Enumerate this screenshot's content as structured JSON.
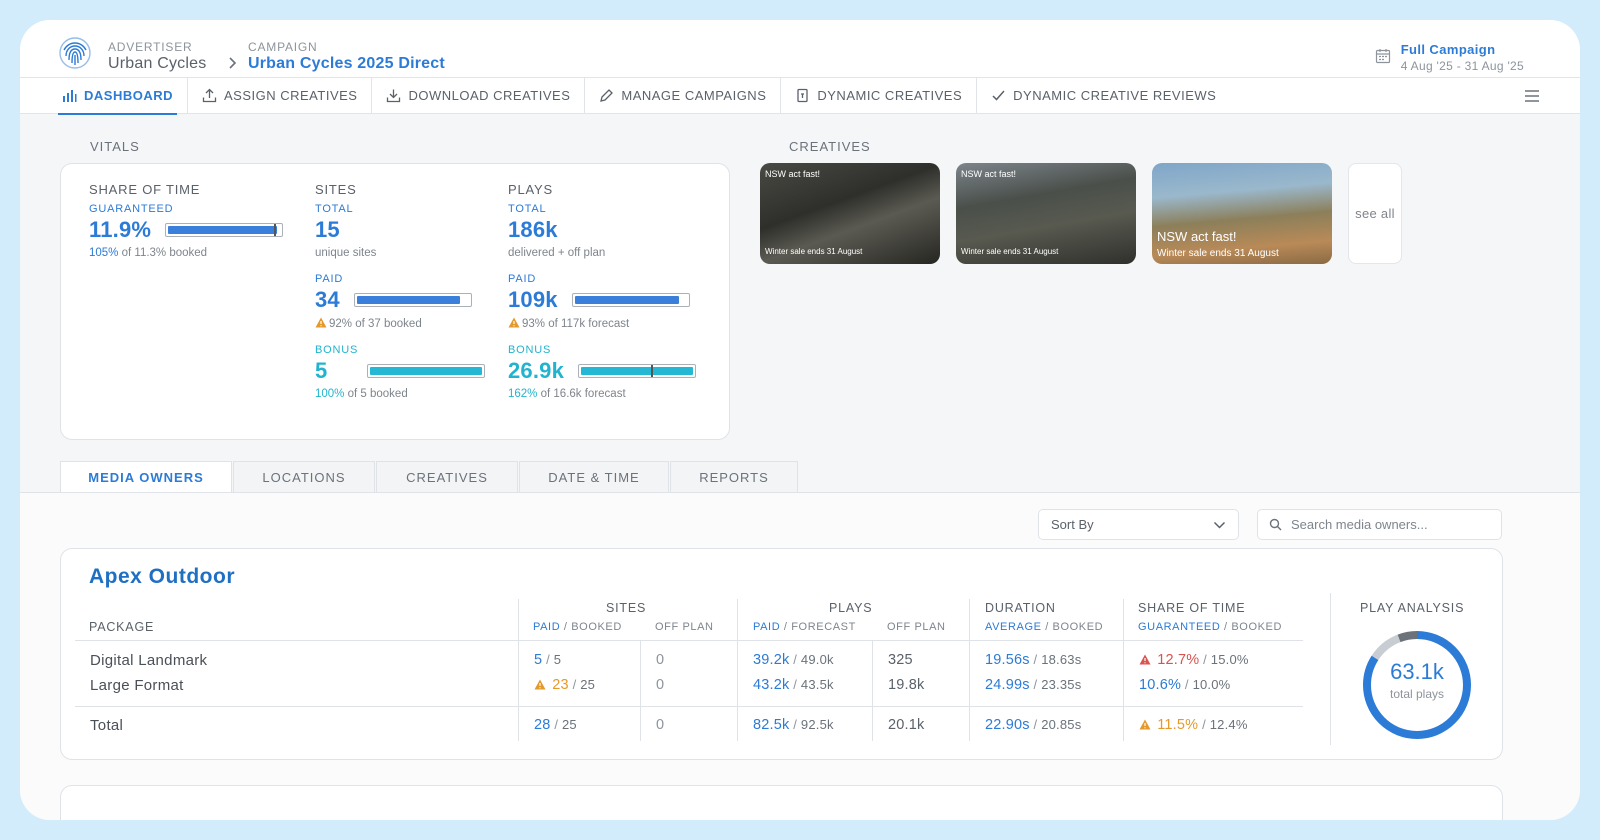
{
  "header": {
    "advertiser_label": "ADVERTISER",
    "advertiser": "Urban Cycles",
    "campaign_label": "CAMPAIGN",
    "campaign": "Urban Cycles 2025 Direct",
    "period_title": "Full Campaign",
    "period_range": "4 Aug '25 - 31 Aug '25"
  },
  "nav": {
    "dashboard": "DASHBOARD",
    "assign": "ASSIGN CREATIVES",
    "download": "DOWNLOAD CREATIVES",
    "manage": "MANAGE CAMPAIGNS",
    "dynamic": "DYNAMIC CREATIVES",
    "reviews": "DYNAMIC CREATIVE REVIEWS"
  },
  "vitals": {
    "label": "VITALS",
    "share": {
      "head": "SHARE OF TIME",
      "sub": "GUARANTEED",
      "value": "11.9%",
      "note_pct": "105%",
      "note_rest": " of 11.3% booked",
      "fill": 0.97
    },
    "sites": {
      "head": "SITES",
      "total_label": "TOTAL",
      "total": "15",
      "total_note": "unique sites",
      "paid_label": "PAID",
      "paid": "34",
      "paid_note": "92% of 37 booked",
      "paid_fill": 0.92,
      "bonus_label": "BONUS",
      "bonus": "5",
      "bonus_note_pct": "100%",
      "bonus_note_rest": " of 5 booked",
      "bonus_fill": 1.0
    },
    "plays": {
      "head": "PLAYS",
      "total_label": "TOTAL",
      "total": "186k",
      "total_note": "delivered + off plan",
      "paid_label": "PAID",
      "paid": "109k",
      "paid_note": "93% of 117k forecast",
      "paid_fill": 0.93,
      "bonus_label": "BONUS",
      "bonus": "26.9k",
      "bonus_note_pct": "162%",
      "bonus_note_rest": " of 16.6k forecast",
      "bonus_fill": 1.0
    }
  },
  "creatives": {
    "label": "CREATIVES",
    "items": [
      {
        "line1": "NSW act fast!",
        "line2": "Winter sale ends 31 August"
      },
      {
        "line1": "NSW act fast!",
        "line2": "Winter sale ends 31 August"
      },
      {
        "line1": "NSW act fast!",
        "line2": "Winter sale ends 31 August"
      }
    ],
    "see_all": "see all"
  },
  "tabs": [
    "MEDIA OWNERS",
    "LOCATIONS",
    "CREATIVES",
    "DATE & TIME",
    "REPORTS"
  ],
  "controls": {
    "sort_label": "Sort By",
    "search_placeholder": "Search media owners..."
  },
  "media_owner": {
    "name": "Apex Outdoor",
    "headers": {
      "package": "PACKAGE",
      "sites": "SITES",
      "plays": "PLAYS",
      "duration": "DURATION",
      "share": "SHARE OF TIME",
      "analysis": "PLAY ANALYSIS",
      "paid": "PAID",
      "booked": "BOOKED",
      "forecast": "FORECAST",
      "off_plan": "OFF PLAN",
      "average": "AVERAGE",
      "guaranteed": "GUARANTEED",
      "slash": " / "
    },
    "rows": [
      {
        "name": "Digital Landmark",
        "sites_paid": "5",
        "sites_booked": "5",
        "sites_off": "0",
        "plays_paid": "39.2k",
        "plays_fc": "49.0k",
        "plays_off": "325",
        "dur_avg": "19.56s",
        "dur_booked": "18.63s",
        "share_g": "12.7%",
        "share_b": "15.0%"
      },
      {
        "name": "Large Format",
        "sites_paid": "23",
        "sites_booked": "25",
        "sites_off": "0",
        "plays_paid": "43.2k",
        "plays_fc": "43.5k",
        "plays_off": "19.8k",
        "dur_avg": "24.99s",
        "dur_booked": "23.35s",
        "share_g": "10.6%",
        "share_b": "10.0%"
      }
    ],
    "total": {
      "name": "Total",
      "sites_paid": "28",
      "sites_booked": "25",
      "sites_off": "0",
      "plays_paid": "82.5k",
      "plays_fc": "92.5k",
      "plays_off": "20.1k",
      "dur_avg": "22.90s",
      "dur_booked": "20.85s",
      "share_g": "11.5%",
      "share_b": "12.4%"
    },
    "donut_value": "63.1k",
    "donut_label": "total plays",
    "donut_segments": [
      0.84,
      0.1,
      0.06
    ]
  },
  "colors": {
    "accent": "#2c7bd6",
    "bonus": "#22b4cf",
    "warning": "#e49a2b",
    "danger": "#d9534f"
  }
}
